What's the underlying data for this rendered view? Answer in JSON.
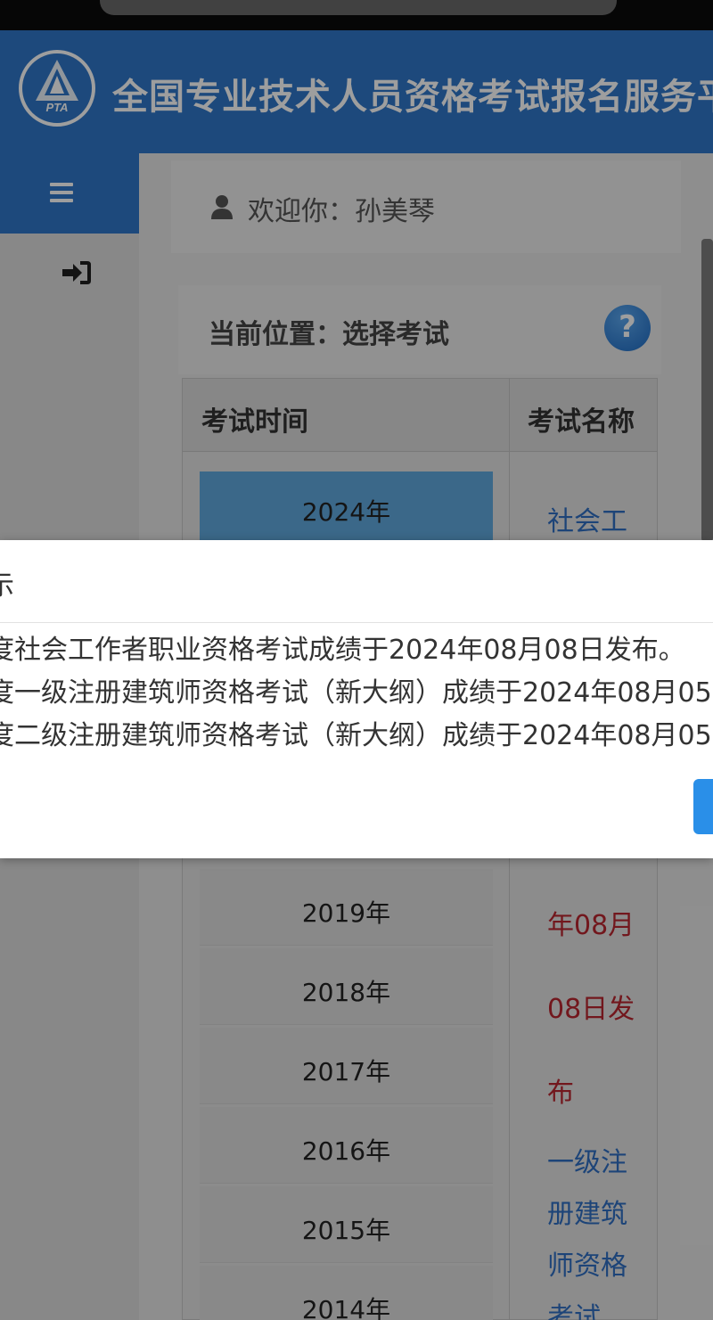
{
  "header": {
    "logo_text": "PTA",
    "site_title": "全国专业技术人员资格考试报名服务平台"
  },
  "user": {
    "welcome": "欢迎你：孙美琴"
  },
  "location": {
    "text": "当前位置：选择考试",
    "help_icon": "?"
  },
  "table": {
    "col_time": "考试时间",
    "col_name": "考试名称",
    "selected_year": "2024年",
    "first_name_fragment": "社会工",
    "years": [
      "2019年",
      "2018年",
      "2017年",
      "2016年",
      "2015年",
      "2014年"
    ],
    "name_fragments": [
      {
        "text": "年08月",
        "color": "red"
      },
      {
        "text": "08日发",
        "color": "red"
      },
      {
        "text": "布",
        "color": "red"
      },
      {
        "text": "一级注",
        "color": "blue"
      },
      {
        "text": "册建筑",
        "color": "blue"
      },
      {
        "text": "师资格",
        "color": "blue"
      },
      {
        "text": "考试",
        "color": "blue"
      }
    ]
  },
  "dialog": {
    "title": "示",
    "messages": [
      "度社会工作者职业资格考试成绩于2024年08月08日发布。",
      "度一级注册建筑师资格考试（新大纲）成绩于2024年08月05",
      "度二级注册建筑师资格考试（新大纲）成绩于2024年08月05"
    ],
    "button_label": ""
  },
  "colors": {
    "brand_blue": "#2f77c9",
    "link_blue": "#2f6fc2",
    "notice_red": "#b9262f",
    "button_blue": "#2a8fe8"
  }
}
